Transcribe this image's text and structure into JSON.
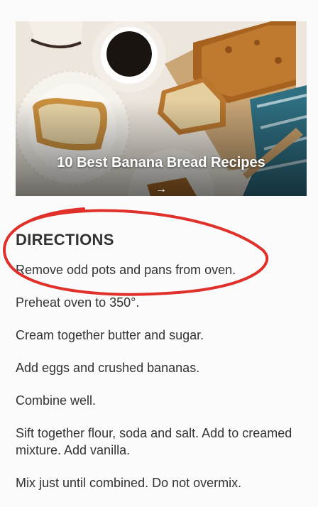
{
  "hero": {
    "title": "10 Best Banana Bread Recipes",
    "arrow": "→"
  },
  "directions": {
    "heading": "DIRECTIONS",
    "steps": [
      "Remove odd pots and pans from oven.",
      "Preheat oven to 350°.",
      "Cream together butter and sugar.",
      "Add eggs and crushed bananas.",
      "Combine well.",
      "Sift together flour, soda and salt. Add to creamed mixture. Add vanilla.",
      "Mix just until combined. Do not overmix."
    ]
  },
  "colors": {
    "annotation": "#e0302a",
    "text": "#333333"
  }
}
